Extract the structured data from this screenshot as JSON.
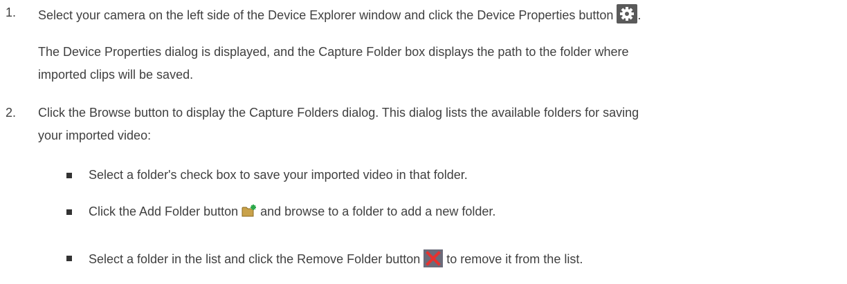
{
  "steps": [
    {
      "number": "1.",
      "text": "Select your camera on the left side of the Device Explorer window and click the Device Properties button",
      "trailing": ".",
      "icon": "gear-icon",
      "paragraph": [
        "The Device Properties dialog is displayed, and the Capture Folder box displays the path to the folder where",
        "imported clips will be saved."
      ]
    },
    {
      "number": "2.",
      "lines": [
        "Click the Browse button to display the Capture Folders dialog. This dialog lists the available folders for saving",
        "your imported video:"
      ],
      "bullets": [
        {
          "text": "Select a folder's check box to save your imported video in that folder."
        },
        {
          "before": "Click the Add Folder button",
          "icon": "add-folder-icon",
          "after": "and browse to a folder to add a new folder."
        },
        {
          "before": "Select a folder in the list and click the Remove Folder button",
          "icon": "remove-folder-icon",
          "after": "to remove it from the list."
        }
      ]
    }
  ],
  "colors": {
    "text": "#3f3f3f",
    "gear_bg": "#5a5a5a",
    "folder": "#c9a24a",
    "remove_bg": "#6b6b7a",
    "remove_x": "#e8312f"
  }
}
